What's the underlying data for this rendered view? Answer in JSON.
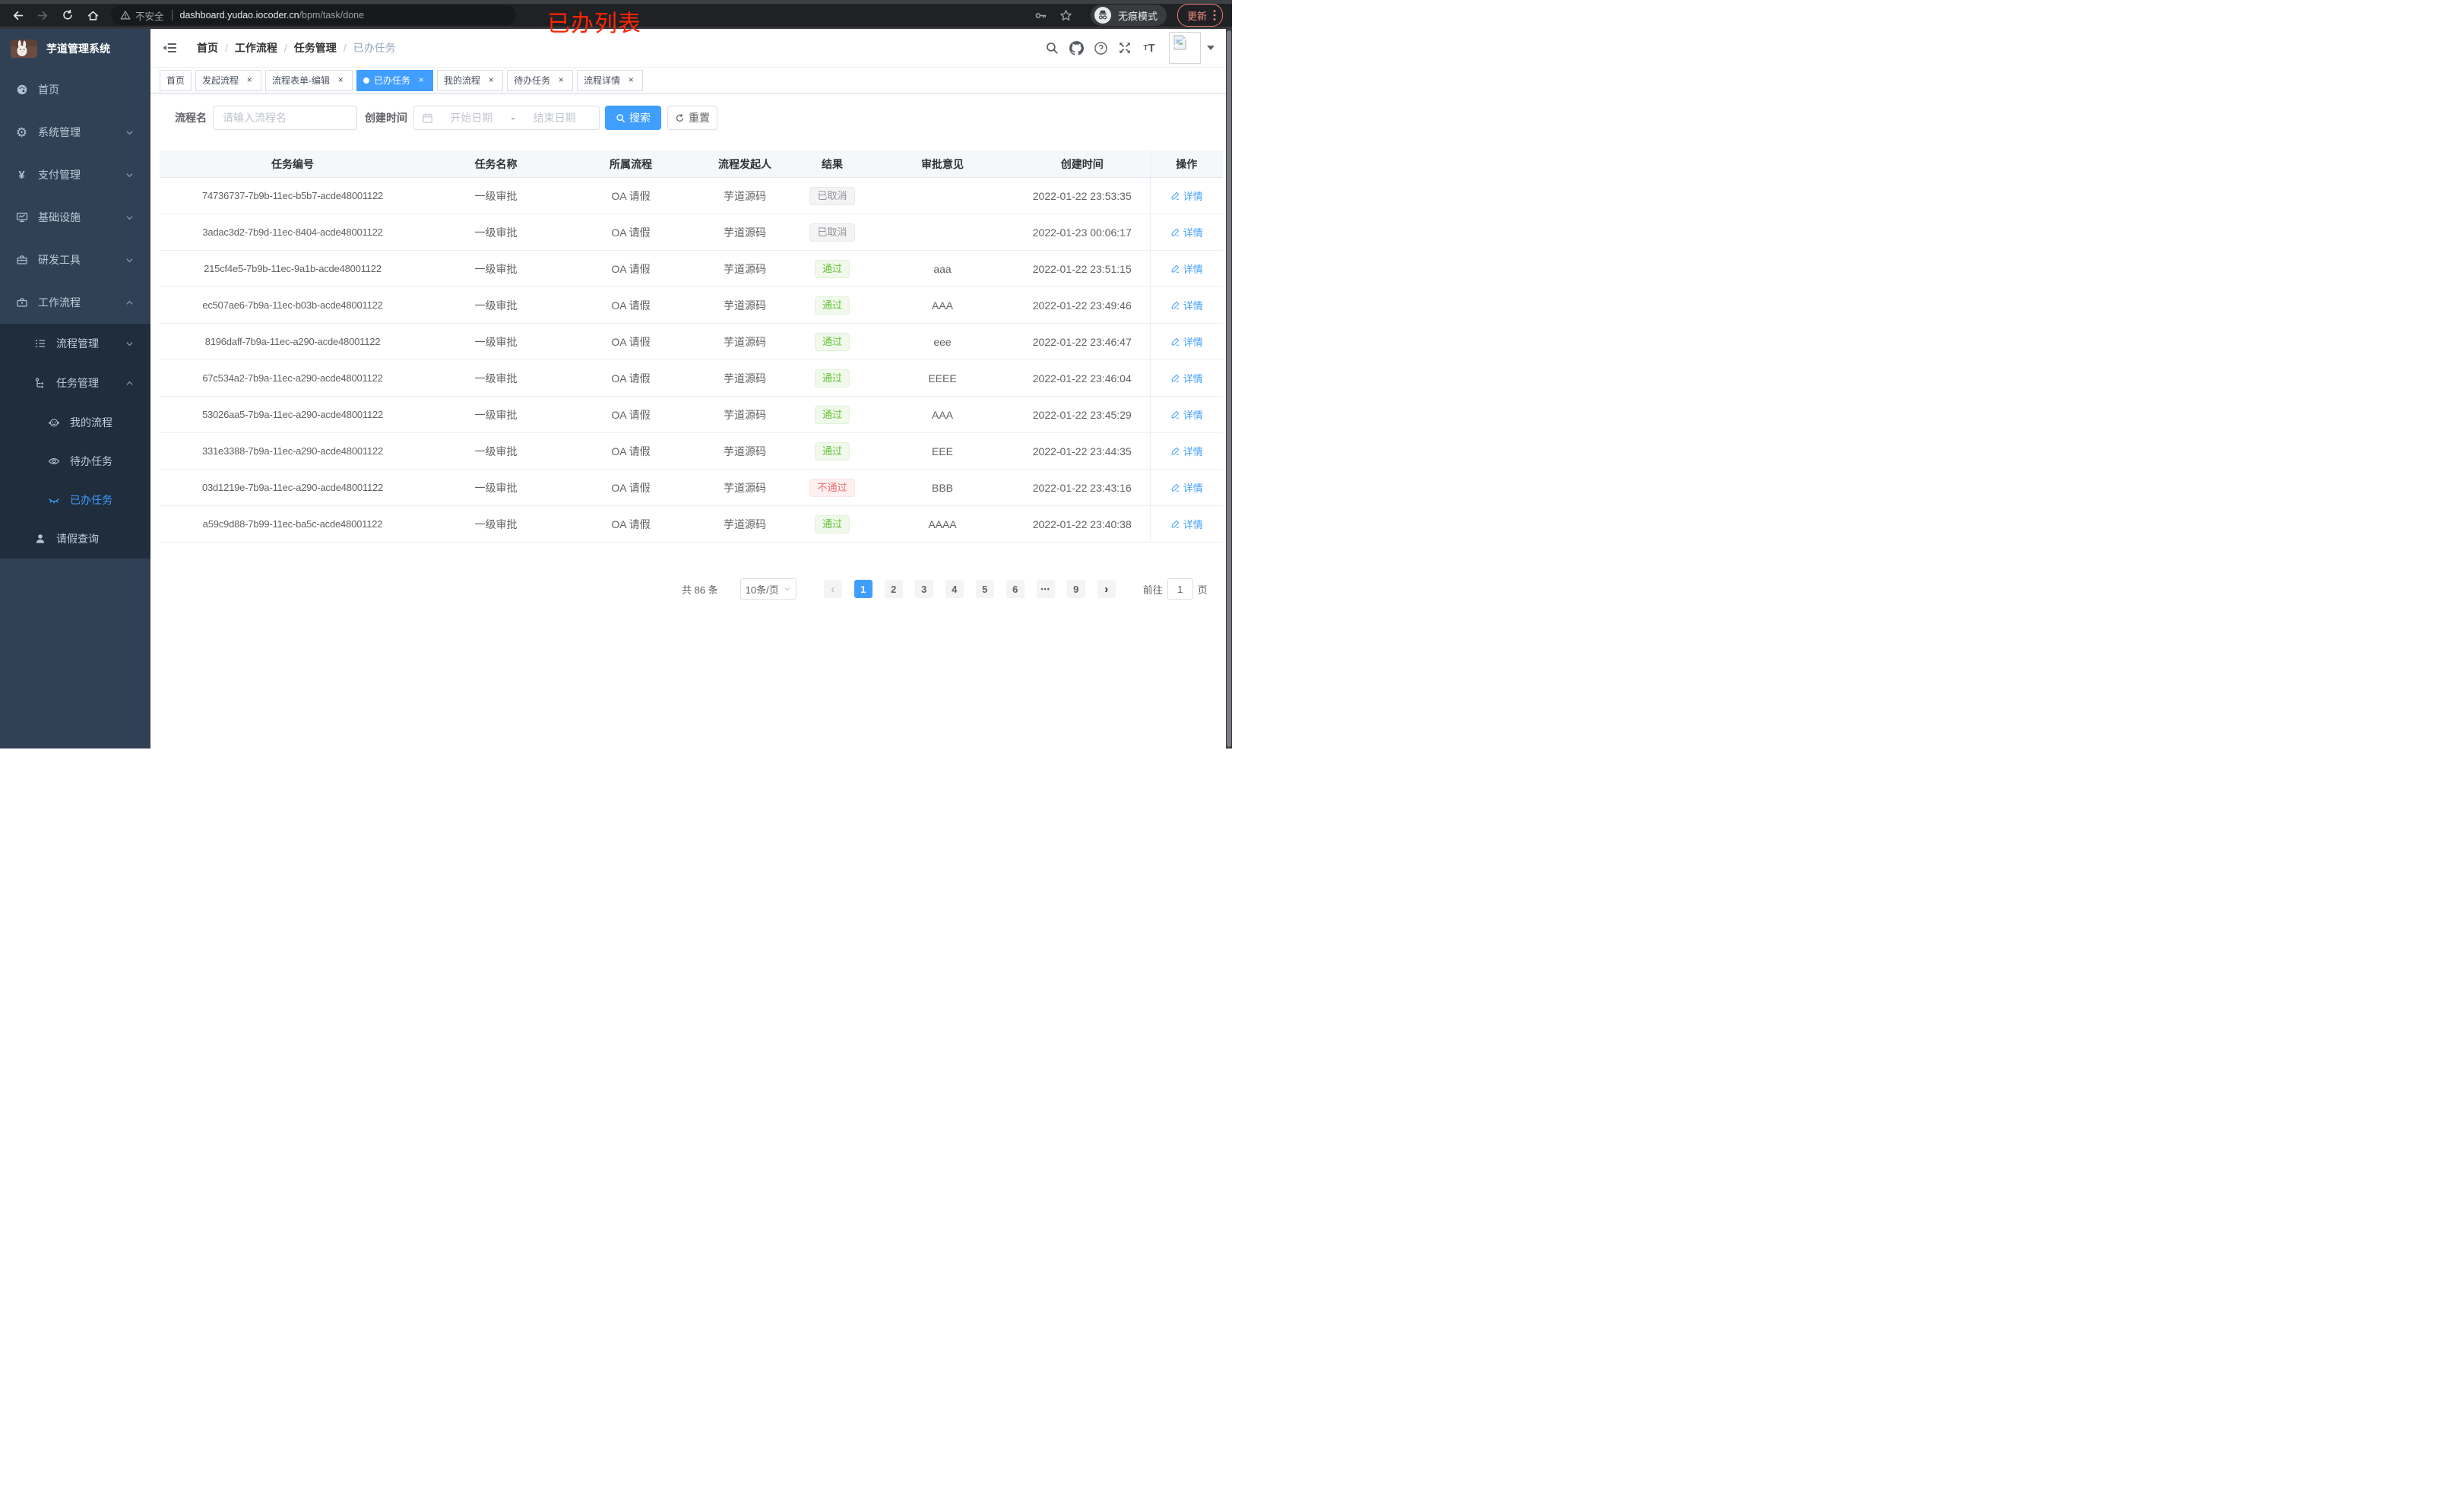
{
  "colors": {
    "accent": "#409eff",
    "success": "#67c23a",
    "danger": "#f56c6c",
    "info": "#909399",
    "sidebar_bg": "#304156",
    "submenu_bg": "#1f2d3d",
    "annotation_red": "#fe2500"
  },
  "glyphs": {
    "close": "×",
    "slash": "/",
    "prev": "‹",
    "next": "›"
  },
  "annotation": {
    "text": "已办列表"
  },
  "browser": {
    "security_label": "不安全",
    "url_host": "dashboard.yudao.iocoder.cn",
    "url_path": "/bpm/task/done",
    "incognito_label": "无痕模式",
    "update_label": "更新"
  },
  "sidebar": {
    "title": "芋道管理系统",
    "menu": {
      "home": "首页",
      "system": "系统管理",
      "pay": "支付管理",
      "infra": "基础设施",
      "dev_tools": "研发工具",
      "workflow": "工作流程",
      "process_mgmt": "流程管理",
      "task_mgmt": "任务管理",
      "my_process": "我的流程",
      "todo_tasks": "待办任务",
      "done_tasks": "已办任务",
      "leave_query": "请假查询"
    }
  },
  "header": {
    "breadcrumb": [
      {
        "label": "首页"
      },
      {
        "label": "工作流程"
      },
      {
        "label": "任务管理"
      },
      {
        "label": "已办任务"
      }
    ]
  },
  "tabs": [
    {
      "label": "首页",
      "active": false,
      "closable": false
    },
    {
      "label": "发起流程",
      "active": false,
      "closable": true
    },
    {
      "label": "流程表单-编辑",
      "active": false,
      "closable": true
    },
    {
      "label": "已办任务",
      "active": true,
      "closable": true
    },
    {
      "label": "我的流程",
      "active": false,
      "closable": true
    },
    {
      "label": "待办任务",
      "active": false,
      "closable": true
    },
    {
      "label": "流程详情",
      "active": false,
      "closable": true
    }
  ],
  "filter": {
    "name_label": "流程名",
    "name_placeholder": "请输入流程名",
    "time_label": "创建时间",
    "start_placeholder": "开始日期",
    "range_separator": "-",
    "end_placeholder": "结束日期",
    "search_label": "搜索",
    "reset_label": "重置"
  },
  "table": {
    "columns": [
      "任务编号",
      "任务名称",
      "所属流程",
      "流程发起人",
      "结果",
      "审批意见",
      "创建时间",
      "操作"
    ],
    "action_label": "详情",
    "rows": [
      {
        "id": "74736737-7b9b-11ec-b5b7-acde48001122",
        "name": "一级审批",
        "process": "OA 请假",
        "starter": "芋道源码",
        "result": "已取消",
        "status": "info",
        "comment": "",
        "created": "2022-01-22 23:53:35"
      },
      {
        "id": "3adac3d2-7b9d-11ec-8404-acde48001122",
        "name": "一级审批",
        "process": "OA 请假",
        "starter": "芋道源码",
        "result": "已取消",
        "status": "info",
        "comment": "",
        "created": "2022-01-23 00:06:17"
      },
      {
        "id": "215cf4e5-7b9b-11ec-9a1b-acde48001122",
        "name": "一级审批",
        "process": "OA 请假",
        "starter": "芋道源码",
        "result": "通过",
        "status": "success",
        "comment": "aaa",
        "created": "2022-01-22 23:51:15"
      },
      {
        "id": "ec507ae6-7b9a-11ec-b03b-acde48001122",
        "name": "一级审批",
        "process": "OA 请假",
        "starter": "芋道源码",
        "result": "通过",
        "status": "success",
        "comment": "AAA",
        "created": "2022-01-22 23:49:46"
      },
      {
        "id": "8196daff-7b9a-11ec-a290-acde48001122",
        "name": "一级审批",
        "process": "OA 请假",
        "starter": "芋道源码",
        "result": "通过",
        "status": "success",
        "comment": "eee",
        "created": "2022-01-22 23:46:47"
      },
      {
        "id": "67c534a2-7b9a-11ec-a290-acde48001122",
        "name": "一级审批",
        "process": "OA 请假",
        "starter": "芋道源码",
        "result": "通过",
        "status": "success",
        "comment": "EEEE",
        "created": "2022-01-22 23:46:04"
      },
      {
        "id": "53026aa5-7b9a-11ec-a290-acde48001122",
        "name": "一级审批",
        "process": "OA 请假",
        "starter": "芋道源码",
        "result": "通过",
        "status": "success",
        "comment": "AAA",
        "created": "2022-01-22 23:45:29"
      },
      {
        "id": "331e3388-7b9a-11ec-a290-acde48001122",
        "name": "一级审批",
        "process": "OA 请假",
        "starter": "芋道源码",
        "result": "通过",
        "status": "success",
        "comment": "EEE",
        "created": "2022-01-22 23:44:35"
      },
      {
        "id": "03d1219e-7b9a-11ec-a290-acde48001122",
        "name": "一级审批",
        "process": "OA 请假",
        "starter": "芋道源码",
        "result": "不通过",
        "status": "danger",
        "comment": "BBB",
        "created": "2022-01-22 23:43:16"
      },
      {
        "id": "a59c9d88-7b99-11ec-ba5c-acde48001122",
        "name": "一级审批",
        "process": "OA 请假",
        "starter": "芋道源码",
        "result": "通过",
        "status": "success",
        "comment": "AAAA",
        "created": "2022-01-22 23:40:38"
      }
    ]
  },
  "pagination": {
    "total_label": "共 86 条",
    "page_size_label": "10条/页",
    "pages": [
      {
        "label": "1",
        "state": "active"
      },
      {
        "label": "2",
        "state": "normal"
      },
      {
        "label": "3",
        "state": "normal"
      },
      {
        "label": "4",
        "state": "normal"
      },
      {
        "label": "5",
        "state": "normal"
      },
      {
        "label": "6",
        "state": "normal"
      },
      {
        "label": "•••",
        "state": "ellipsis"
      },
      {
        "label": "9",
        "state": "normal"
      }
    ],
    "goto_label": "前往",
    "goto_value": "1",
    "page_unit": "页"
  }
}
